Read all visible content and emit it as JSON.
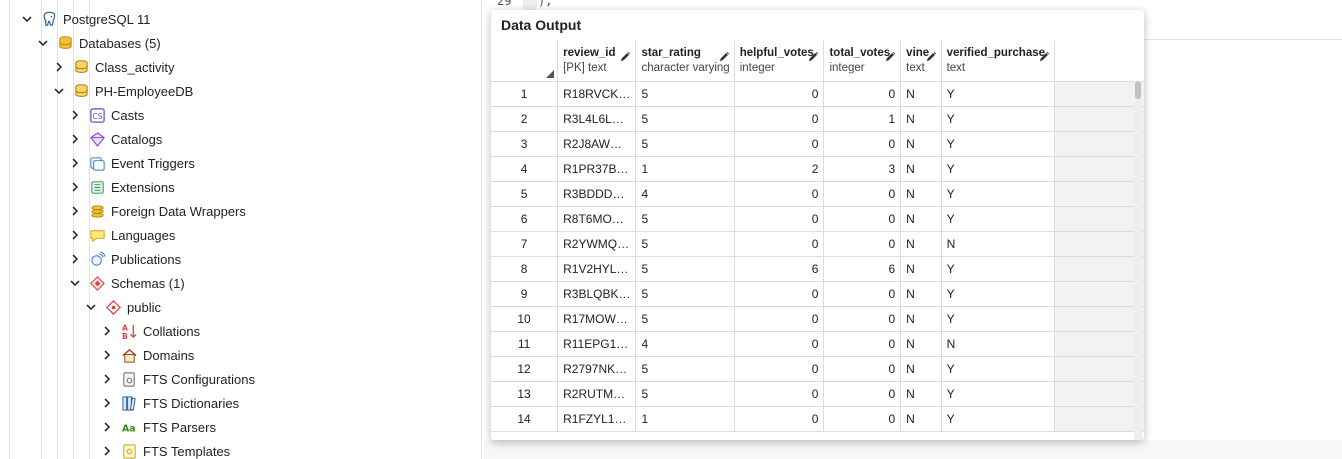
{
  "editor": {
    "line_number": "29",
    "code_fragment": ");"
  },
  "tree": {
    "items": [
      {
        "label": "PostgreSQL 11",
        "icon": "elephant-server-icon",
        "indent": 0,
        "expanded": true
      },
      {
        "label": "Databases (5)",
        "icon": "databases-icon",
        "indent": 1,
        "expanded": true
      },
      {
        "label": "Class_activity",
        "icon": "database-icon",
        "indent": 2,
        "expanded": false
      },
      {
        "label": "PH-EmployeeDB",
        "icon": "database-icon",
        "indent": 2,
        "expanded": true
      },
      {
        "label": "Casts",
        "icon": "casts-icon",
        "indent": 3,
        "expanded": false
      },
      {
        "label": "Catalogs",
        "icon": "catalogs-icon",
        "indent": 3,
        "expanded": false
      },
      {
        "label": "Event Triggers",
        "icon": "event-triggers-icon",
        "indent": 3,
        "expanded": false
      },
      {
        "label": "Extensions",
        "icon": "extensions-icon",
        "indent": 3,
        "expanded": false
      },
      {
        "label": "Foreign Data Wrappers",
        "icon": "foreign-data-wrappers-icon",
        "indent": 3,
        "expanded": false
      },
      {
        "label": "Languages",
        "icon": "languages-icon",
        "indent": 3,
        "expanded": false
      },
      {
        "label": "Publications",
        "icon": "publications-icon",
        "indent": 3,
        "expanded": false
      },
      {
        "label": "Schemas (1)",
        "icon": "schemas-icon",
        "indent": 3,
        "expanded": true
      },
      {
        "label": "public",
        "icon": "schema-icon",
        "indent": 4,
        "expanded": true
      },
      {
        "label": "Collations",
        "icon": "collations-icon",
        "indent": 5,
        "expanded": false
      },
      {
        "label": "Domains",
        "icon": "domains-icon",
        "indent": 5,
        "expanded": false
      },
      {
        "label": "FTS Configurations",
        "icon": "fts-configurations-icon",
        "indent": 5,
        "expanded": false
      },
      {
        "label": "FTS Dictionaries",
        "icon": "fts-dictionaries-icon",
        "indent": 5,
        "expanded": false
      },
      {
        "label": "FTS Parsers",
        "icon": "fts-parsers-icon",
        "indent": 5,
        "expanded": false
      },
      {
        "label": "FTS Templates",
        "icon": "fts-templates-icon",
        "indent": 5,
        "expanded": false
      }
    ]
  },
  "output": {
    "title": "Data Output",
    "columns": [
      {
        "name": "review_id",
        "type": "[PK] text",
        "align": "left"
      },
      {
        "name": "star_rating",
        "type": "character varying",
        "align": "left"
      },
      {
        "name": "helpful_votes",
        "type": "integer",
        "align": "right"
      },
      {
        "name": "total_votes",
        "type": "integer",
        "align": "right"
      },
      {
        "name": "vine",
        "type": "text",
        "align": "left"
      },
      {
        "name": "verified_purchase",
        "type": "text",
        "align": "left"
      }
    ],
    "rows": [
      {
        "n": "1",
        "cells": [
          "R18RVCK…",
          "5",
          "0",
          "0",
          "N",
          "Y"
        ]
      },
      {
        "n": "2",
        "cells": [
          "R3L4L6L…",
          "5",
          "0",
          "1",
          "N",
          "Y"
        ]
      },
      {
        "n": "3",
        "cells": [
          "R2J8AW…",
          "5",
          "0",
          "0",
          "N",
          "Y"
        ]
      },
      {
        "n": "4",
        "cells": [
          "R1PR37B…",
          "1",
          "2",
          "3",
          "N",
          "Y"
        ]
      },
      {
        "n": "5",
        "cells": [
          "R3BDDD…",
          "4",
          "0",
          "0",
          "N",
          "Y"
        ]
      },
      {
        "n": "6",
        "cells": [
          "R8T6MO…",
          "5",
          "0",
          "0",
          "N",
          "Y"
        ]
      },
      {
        "n": "7",
        "cells": [
          "R2YWMQ…",
          "5",
          "0",
          "0",
          "N",
          "N"
        ]
      },
      {
        "n": "8",
        "cells": [
          "R1V2HYL…",
          "5",
          "6",
          "6",
          "N",
          "Y"
        ]
      },
      {
        "n": "9",
        "cells": [
          "R3BLQBK…",
          "5",
          "0",
          "0",
          "N",
          "Y"
        ]
      },
      {
        "n": "10",
        "cells": [
          "R17MOW…",
          "5",
          "0",
          "0",
          "N",
          "Y"
        ]
      },
      {
        "n": "11",
        "cells": [
          "R11EPG1…",
          "4",
          "0",
          "0",
          "N",
          "N"
        ]
      },
      {
        "n": "12",
        "cells": [
          "R2797NK…",
          "5",
          "0",
          "0",
          "N",
          "Y"
        ]
      },
      {
        "n": "13",
        "cells": [
          "R2RUTM…",
          "5",
          "0",
          "0",
          "N",
          "Y"
        ]
      },
      {
        "n": "14",
        "cells": [
          "R1FZYL1…",
          "1",
          "0",
          "0",
          "N",
          "Y"
        ]
      }
    ]
  }
}
